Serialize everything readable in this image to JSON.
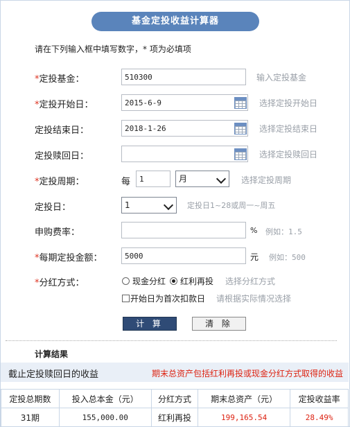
{
  "title": "基金定投收益计算器",
  "intro": "请在下列输入框中填写数字，* 项为必填项",
  "required_mark": "*",
  "fields": {
    "fund": {
      "label": "定投基金：",
      "value": "510300",
      "hint": "输入定投基金"
    },
    "start": {
      "label": "定投开始日：",
      "value": "2015-6-9",
      "hint": "选择定投开始日"
    },
    "end": {
      "label": "定投结束日：",
      "value": "2018-1-26",
      "hint": "选择定投结束日"
    },
    "redeem": {
      "label": "定投赎回日：",
      "value": "",
      "hint": "选择定投赎回日"
    },
    "period": {
      "label": "定投周期：",
      "prefix": "每",
      "count": "1",
      "unit": "月",
      "hint": "选择定投周期"
    },
    "day": {
      "label": "定投日：",
      "value": "1",
      "hint": "定投日1~28或周一~周五"
    },
    "fee": {
      "label": "申购费率：",
      "value": "",
      "unit": "%",
      "hint": "例如：1.5"
    },
    "amount": {
      "label": "每期定投金额：",
      "value": "5000",
      "unit": "元",
      "hint": "例如：500"
    },
    "dividend": {
      "label": "分红方式：",
      "option_cash": "现金分红",
      "option_reinvest": "红利再投",
      "selected": "红利再投",
      "hint": "选择分红方式",
      "first_deduct_label": "开始日为首次扣款日",
      "first_deduct_checked": false,
      "first_deduct_hint": "请根据实际情况选择"
    }
  },
  "buttons": {
    "calculate": "计 算",
    "clear": "清 除"
  },
  "results": {
    "title": "计算结果",
    "subtitle": "截止定投赎回日的收益",
    "note": "期末总资产包括红利再投或现金分红方式取得的收益",
    "columns": [
      "定投总期数",
      "投入总本金（元）",
      "分红方式",
      "期末总资产（元）",
      "定投收益率"
    ],
    "row": {
      "periods": "31期",
      "principal": "155,000.00",
      "dividend_mode": "红利再投",
      "final_assets": "199,165.54",
      "return_rate": "28.49%"
    }
  },
  "colors": {
    "accent": "#5a84bb",
    "button_dark": "#2f4b76",
    "required": "#dd3322",
    "result_red": "#dd2211",
    "hint": "#9aa0a8"
  },
  "icons": [
    "calendar-icon",
    "chevron-down-icon"
  ]
}
